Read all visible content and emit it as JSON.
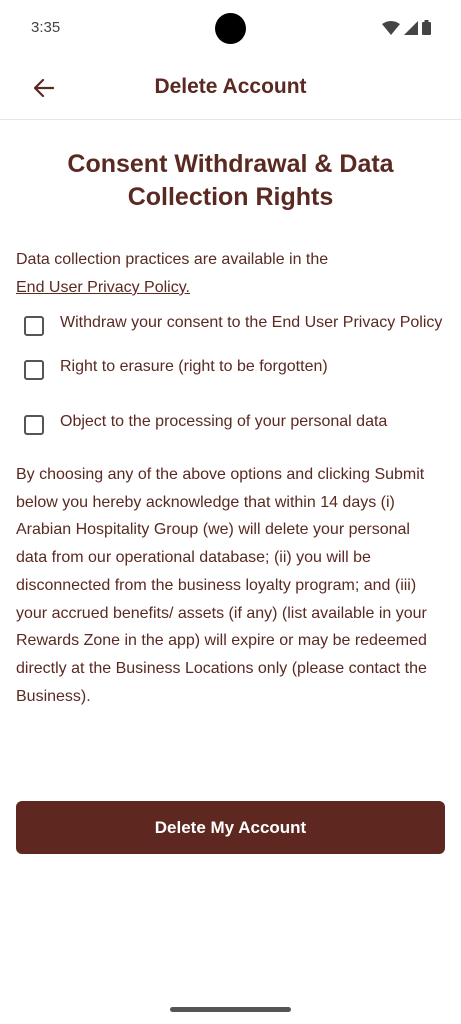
{
  "status_bar": {
    "time": "3:35",
    "icons": [
      "wifi-icon",
      "signal-icon",
      "battery-icon"
    ]
  },
  "app_bar": {
    "back_icon": "arrow-left-icon",
    "title": "Delete Account"
  },
  "heading": "Consent Withdrawal & Data Collection Rights",
  "intro": {
    "text": "Data collection practices are available in the",
    "link": "End User Privacy Policy."
  },
  "options": [
    {
      "label": "Withdraw your consent to the End User Privacy Policy",
      "checked": false
    },
    {
      "label": "Right to erasure (right to be forgotten)",
      "checked": false
    },
    {
      "label": "Object to the processing of your personal data",
      "checked": false
    }
  ],
  "disclaimer": "By choosing any of the above options and clicking Submit below you hereby acknowledge that within 14 days (i) Arabian Hospitality Group (we) will delete your personal data from our operational database; (ii) you will be disconnected from the business loyalty program; and (iii) your accrued benefits/ assets (if any) (list available in your Rewards Zone in the app) will expire or may be redeemed directly at the Business Locations only (please contact the Business).",
  "delete_button": "Delete My Account",
  "colors": {
    "accent": "#5e2821",
    "text": "#5a2a22"
  }
}
